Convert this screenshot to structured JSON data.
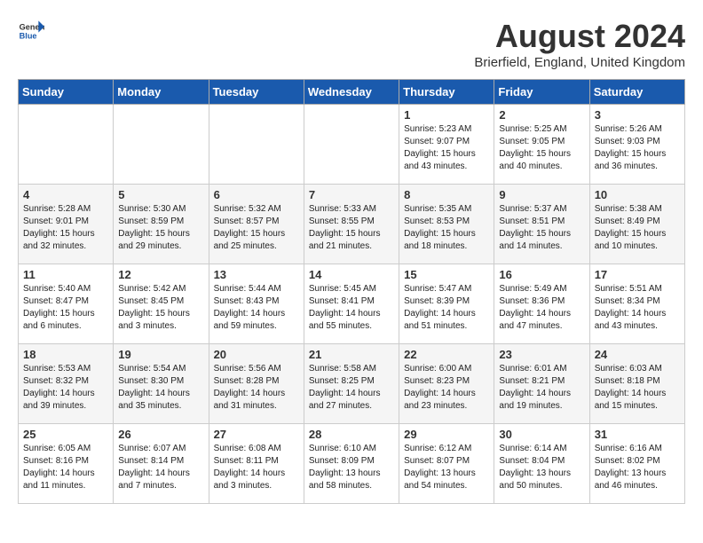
{
  "header": {
    "logo_general": "General",
    "logo_blue": "Blue",
    "month_year": "August 2024",
    "location": "Brierfield, England, United Kingdom"
  },
  "days_of_week": [
    "Sunday",
    "Monday",
    "Tuesday",
    "Wednesday",
    "Thursday",
    "Friday",
    "Saturday"
  ],
  "weeks": [
    [
      {
        "day": "",
        "info": ""
      },
      {
        "day": "",
        "info": ""
      },
      {
        "day": "",
        "info": ""
      },
      {
        "day": "",
        "info": ""
      },
      {
        "day": "1",
        "info": "Sunrise: 5:23 AM\nSunset: 9:07 PM\nDaylight: 15 hours\nand 43 minutes."
      },
      {
        "day": "2",
        "info": "Sunrise: 5:25 AM\nSunset: 9:05 PM\nDaylight: 15 hours\nand 40 minutes."
      },
      {
        "day": "3",
        "info": "Sunrise: 5:26 AM\nSunset: 9:03 PM\nDaylight: 15 hours\nand 36 minutes."
      }
    ],
    [
      {
        "day": "4",
        "info": "Sunrise: 5:28 AM\nSunset: 9:01 PM\nDaylight: 15 hours\nand 32 minutes."
      },
      {
        "day": "5",
        "info": "Sunrise: 5:30 AM\nSunset: 8:59 PM\nDaylight: 15 hours\nand 29 minutes."
      },
      {
        "day": "6",
        "info": "Sunrise: 5:32 AM\nSunset: 8:57 PM\nDaylight: 15 hours\nand 25 minutes."
      },
      {
        "day": "7",
        "info": "Sunrise: 5:33 AM\nSunset: 8:55 PM\nDaylight: 15 hours\nand 21 minutes."
      },
      {
        "day": "8",
        "info": "Sunrise: 5:35 AM\nSunset: 8:53 PM\nDaylight: 15 hours\nand 18 minutes."
      },
      {
        "day": "9",
        "info": "Sunrise: 5:37 AM\nSunset: 8:51 PM\nDaylight: 15 hours\nand 14 minutes."
      },
      {
        "day": "10",
        "info": "Sunrise: 5:38 AM\nSunset: 8:49 PM\nDaylight: 15 hours\nand 10 minutes."
      }
    ],
    [
      {
        "day": "11",
        "info": "Sunrise: 5:40 AM\nSunset: 8:47 PM\nDaylight: 15 hours\nand 6 minutes."
      },
      {
        "day": "12",
        "info": "Sunrise: 5:42 AM\nSunset: 8:45 PM\nDaylight: 15 hours\nand 3 minutes."
      },
      {
        "day": "13",
        "info": "Sunrise: 5:44 AM\nSunset: 8:43 PM\nDaylight: 14 hours\nand 59 minutes."
      },
      {
        "day": "14",
        "info": "Sunrise: 5:45 AM\nSunset: 8:41 PM\nDaylight: 14 hours\nand 55 minutes."
      },
      {
        "day": "15",
        "info": "Sunrise: 5:47 AM\nSunset: 8:39 PM\nDaylight: 14 hours\nand 51 minutes."
      },
      {
        "day": "16",
        "info": "Sunrise: 5:49 AM\nSunset: 8:36 PM\nDaylight: 14 hours\nand 47 minutes."
      },
      {
        "day": "17",
        "info": "Sunrise: 5:51 AM\nSunset: 8:34 PM\nDaylight: 14 hours\nand 43 minutes."
      }
    ],
    [
      {
        "day": "18",
        "info": "Sunrise: 5:53 AM\nSunset: 8:32 PM\nDaylight: 14 hours\nand 39 minutes."
      },
      {
        "day": "19",
        "info": "Sunrise: 5:54 AM\nSunset: 8:30 PM\nDaylight: 14 hours\nand 35 minutes."
      },
      {
        "day": "20",
        "info": "Sunrise: 5:56 AM\nSunset: 8:28 PM\nDaylight: 14 hours\nand 31 minutes."
      },
      {
        "day": "21",
        "info": "Sunrise: 5:58 AM\nSunset: 8:25 PM\nDaylight: 14 hours\nand 27 minutes."
      },
      {
        "day": "22",
        "info": "Sunrise: 6:00 AM\nSunset: 8:23 PM\nDaylight: 14 hours\nand 23 minutes."
      },
      {
        "day": "23",
        "info": "Sunrise: 6:01 AM\nSunset: 8:21 PM\nDaylight: 14 hours\nand 19 minutes."
      },
      {
        "day": "24",
        "info": "Sunrise: 6:03 AM\nSunset: 8:18 PM\nDaylight: 14 hours\nand 15 minutes."
      }
    ],
    [
      {
        "day": "25",
        "info": "Sunrise: 6:05 AM\nSunset: 8:16 PM\nDaylight: 14 hours\nand 11 minutes."
      },
      {
        "day": "26",
        "info": "Sunrise: 6:07 AM\nSunset: 8:14 PM\nDaylight: 14 hours\nand 7 minutes."
      },
      {
        "day": "27",
        "info": "Sunrise: 6:08 AM\nSunset: 8:11 PM\nDaylight: 14 hours\nand 3 minutes."
      },
      {
        "day": "28",
        "info": "Sunrise: 6:10 AM\nSunset: 8:09 PM\nDaylight: 13 hours\nand 58 minutes."
      },
      {
        "day": "29",
        "info": "Sunrise: 6:12 AM\nSunset: 8:07 PM\nDaylight: 13 hours\nand 54 minutes."
      },
      {
        "day": "30",
        "info": "Sunrise: 6:14 AM\nSunset: 8:04 PM\nDaylight: 13 hours\nand 50 minutes."
      },
      {
        "day": "31",
        "info": "Sunrise: 6:16 AM\nSunset: 8:02 PM\nDaylight: 13 hours\nand 46 minutes."
      }
    ]
  ]
}
